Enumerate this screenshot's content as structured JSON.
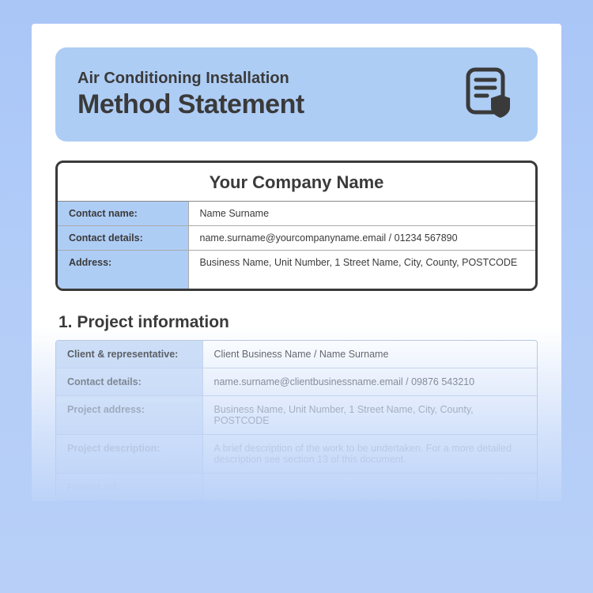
{
  "banner": {
    "subtitle": "Air Conditioning Installation",
    "title": "Method Statement"
  },
  "company": {
    "heading": "Your Company Name",
    "rows": [
      {
        "label": "Contact name:",
        "value": "Name Surname"
      },
      {
        "label": "Contact details:",
        "value": "name.surname@yourcompanyname.email  / 01234 567890"
      },
      {
        "label": "Address:",
        "value": "Business Name, Unit Number, 1 Street Name, City, County, POSTCODE"
      }
    ]
  },
  "section1": {
    "heading": "1. Project information",
    "rows": [
      {
        "label": "Client & representative:",
        "value": "Client Business Name  /  Name Surname"
      },
      {
        "label": "Contact details:",
        "value": "name.surname@clientbusinessname.email  / 09876 543210"
      },
      {
        "label": "Project address:",
        "value": "Business Name, Unit Number, 1 Street Name, City, County, POSTCODE"
      },
      {
        "label": "Project description:",
        "value": "A brief description of the work to be undertaken. For a more detailed description see section 13 of this document."
      },
      {
        "label": "Project ref:",
        "value": ""
      }
    ]
  }
}
